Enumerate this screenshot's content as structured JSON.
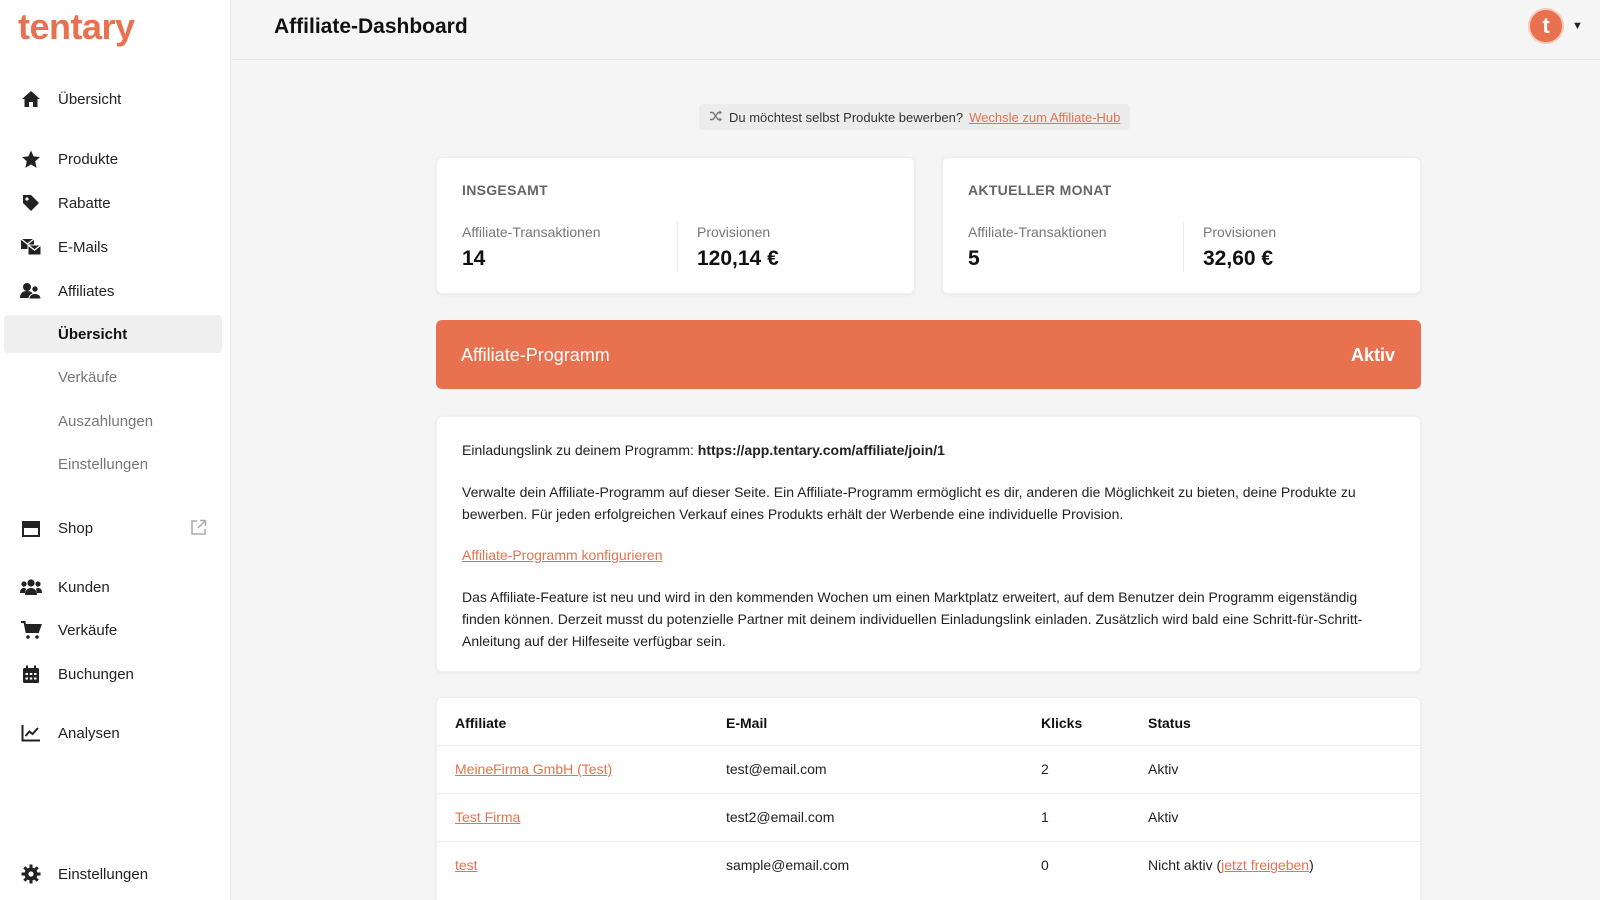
{
  "app": {
    "logo": "tentary"
  },
  "header": {
    "title": "Affiliate-Dashboard",
    "avatar_letter": "t"
  },
  "sidebar": {
    "items": [
      {
        "label": "Übersicht",
        "icon": "home-icon"
      },
      {
        "label": "Produkte",
        "icon": "star-icon"
      },
      {
        "label": "Rabatte",
        "icon": "tag-icon"
      },
      {
        "label": "E-Mails",
        "icon": "mail-icon"
      },
      {
        "label": "Affiliates",
        "icon": "users-icon"
      }
    ],
    "affiliates_sub": [
      {
        "label": "Übersicht",
        "active": true
      },
      {
        "label": "Verkäufe"
      },
      {
        "label": "Auszahlungen"
      },
      {
        "label": "Einstellungen"
      }
    ],
    "items2": [
      {
        "label": "Shop",
        "icon": "store-icon"
      },
      {
        "label": "Kunden",
        "icon": "customers-icon"
      },
      {
        "label": "Verkäufe",
        "icon": "cart-icon"
      },
      {
        "label": "Buchungen",
        "icon": "calendar-icon"
      },
      {
        "label": "Analysen",
        "icon": "chart-icon"
      }
    ],
    "settings": {
      "label": "Einstellungen",
      "icon": "gear-icon"
    }
  },
  "notice": {
    "text": "Du möchtest selbst Produkte bewerben?",
    "link": "Wechsle zum Affiliate-Hub"
  },
  "stats": {
    "total": {
      "title": "INSGESAMT",
      "transactions_label": "Affiliate-Transaktionen",
      "transactions_value": "14",
      "commissions_label": "Provisionen",
      "commissions_value": "120,14 €"
    },
    "month": {
      "title": "AKTUELLER MONAT",
      "transactions_label": "Affiliate-Transaktionen",
      "transactions_value": "5",
      "commissions_label": "Provisionen",
      "commissions_value": "32,60 €"
    }
  },
  "program": {
    "title": "Affiliate-Programm",
    "status": "Aktiv"
  },
  "info": {
    "invite_label": "Einladungslink zu deinem Programm:",
    "invite_url": "https://app.tentary.com/affiliate/join/1",
    "description": "Verwalte dein Affiliate-Programm auf dieser Seite. Ein Affiliate-Programm ermöglicht es dir, anderen die Möglichkeit zu bieten, deine Produkte zu bewerben. Für jeden erfolgreichen Verkauf eines Produkts erhält der Werbende eine individuelle Provision.",
    "configure_link": "Affiliate-Programm konfigurieren",
    "feature_note": "Das Affiliate-Feature ist neu und wird in den kommenden Wochen um einen Marktplatz erweitert, auf dem Benutzer dein Programm eigenständig finden können. Derzeit musst du potenzielle Partner mit deinem individuellen Einladungslink einladen. Zusätzlich wird bald eine Schritt-für-Schritt-Anleitung auf der Hilfeseite verfügbar sein."
  },
  "table": {
    "headers": [
      "Affiliate",
      "E-Mail",
      "Klicks",
      "Status"
    ],
    "rows": [
      {
        "affiliate": "MeineFirma GmbH (Test)",
        "email": "test@email.com",
        "clicks": "2",
        "status": "Aktiv",
        "action": ""
      },
      {
        "affiliate": "Test Firma",
        "email": "test2@email.com",
        "clicks": "1",
        "status": "Aktiv",
        "action": ""
      },
      {
        "affiliate": "test",
        "email": "sample@email.com",
        "clicks": "0",
        "status": "Nicht aktiv (",
        "action": "jetzt freigeben",
        "status_close": ")"
      }
    ]
  },
  "colors": {
    "accent": "#e8714f",
    "background": "#f5f5f5",
    "card": "#ffffff"
  }
}
